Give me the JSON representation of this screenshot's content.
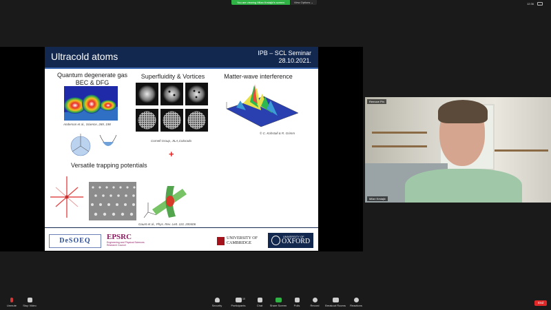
{
  "top_bar": {
    "share_text": "You are viewing Milan Krstajić's screen",
    "view_options": "View Options ⌄",
    "clock": "12:36"
  },
  "slide": {
    "title": "Ultracold atoms",
    "seminar_line1": "IPB – SCL Seminar",
    "seminar_line2": "28.10.2021.",
    "sections": {
      "qdg_line1": "Quantum degenerate gas",
      "qdg_line2": "BEC & DFG",
      "superfluid": "Superfluidity & Vortices",
      "matterwave": "Matter-wave interference",
      "trapping": "Versatile trapping potentials"
    },
    "captions": {
      "anderson": "Anderson et al., Science, 269, 198",
      "cornell": "Cornell Group, JILA,Colorado",
      "kohstall": "© C. Kohstall & R. Grimm",
      "gaunt": "Gaunt et al., Phys. Rev. Lett. 110, 200406"
    },
    "logos": {
      "deseq": "DeSOEQ",
      "epsrc_name": "EPSRC",
      "epsrc_sub1": "Engineering and Physical Sciences",
      "epsrc_sub2": "Research Council",
      "cambridge1": "UNIVERSITY OF",
      "cambridge2": "CAMBRIDGE",
      "oxford_small": "UNIVERSITY OF",
      "oxford_name": "OXFORD"
    },
    "plus": "+"
  },
  "webcam": {
    "label": "Remove Pin",
    "name": "Milan Krstajić"
  },
  "toolbar": {
    "items": [
      "Unmute",
      "Stop Video",
      "Security",
      "Participants",
      "Chat",
      "Share Screen",
      "Polls",
      "Record",
      "Breakout Rooms",
      "Reactions"
    ],
    "participants_count": "10",
    "end": "End"
  },
  "colors": {
    "slide_header": "#13284f",
    "share_green": "#2fb344",
    "end_red": "#e02828"
  }
}
